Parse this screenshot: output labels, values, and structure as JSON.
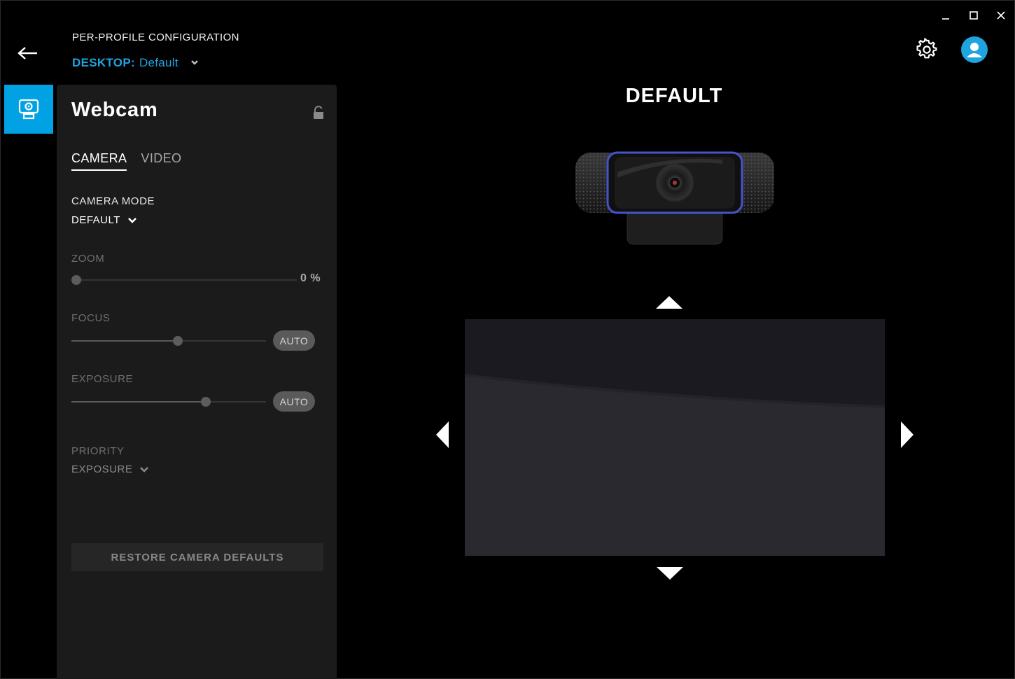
{
  "header": {
    "title": "PER-PROFILE CONFIGURATION",
    "profile_key": "DESKTOP:",
    "profile_value": "Default"
  },
  "panel": {
    "title": "Webcam",
    "tabs": [
      {
        "label": "CAMERA",
        "active": true
      },
      {
        "label": "VIDEO",
        "active": false
      }
    ],
    "camera_mode": {
      "label": "CAMERA MODE",
      "value": "DEFAULT"
    },
    "zoom": {
      "label": "ZOOM",
      "value_text": "0 %",
      "level": 0
    },
    "focus": {
      "label": "FOCUS",
      "level": 0.55,
      "auto_label": "AUTO"
    },
    "exposure": {
      "label": "EXPOSURE",
      "level": 0.7,
      "auto_label": "AUTO"
    },
    "priority": {
      "label": "PRIORITY",
      "value": "EXPOSURE"
    },
    "restore_label": "RESTORE CAMERA DEFAULTS"
  },
  "main": {
    "title": "DEFAULT"
  },
  "icons": {
    "back": "arrow-left-icon",
    "settings": "gear-icon",
    "account": "user-icon",
    "device": "webcam-icon",
    "lock": "unlock-icon"
  },
  "colors": {
    "accent": "#00a2e3",
    "background": "#000000",
    "panel": "#1b1b1b"
  }
}
